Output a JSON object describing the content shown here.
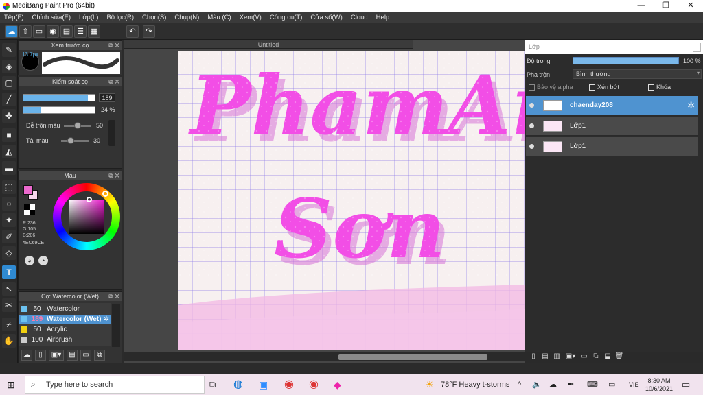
{
  "window": {
    "title": "MediBang Paint Pro (64bit)",
    "minimize": "—",
    "maximize": "❐",
    "close": "✕"
  },
  "menu": [
    "Tệp(F)",
    "Chỉnh sửa(E)",
    "Lớp(L)",
    "Bộ lọc(R)",
    "Chọn(S)",
    "Chụp(N)",
    "Màu (C)",
    "Xem(V)",
    "Công cụ(T)",
    "Cửa sổ(W)",
    "Cloud",
    "Help"
  ],
  "preview": {
    "title": "Xem trước cọ",
    "size_value": "13.7px"
  },
  "brush_control": {
    "title": "Kiểm soát cọ",
    "size": "189",
    "opacity": "24 %",
    "opacity_level": 0.24,
    "size_level": 0.9,
    "mix_label": "Dễ trộn màu",
    "mix_value": "50",
    "mix_level": 0.5,
    "paint_label": "Tải màu",
    "paint_value": "30",
    "paint_level": 0.3
  },
  "color": {
    "title": "Màu",
    "r": "R:236",
    "g": "G:105",
    "b": "B:206",
    "hex": "#EC69CE",
    "fg": "#ec69ce",
    "bg": "#f6d6ec"
  },
  "brush_list": {
    "title": "Cọ: Watercolor (Wet)",
    "items": [
      {
        "size": "50",
        "name": "Watercolor",
        "color": "#6cc2f0"
      },
      {
        "size": "189",
        "name": "Watercolor (Wet)",
        "color": "#6cc2f0"
      },
      {
        "size": "50",
        "name": "Acrylic",
        "color": "#f0d010"
      },
      {
        "size": "100",
        "name": "Airbrush",
        "color": "#cccccc"
      }
    ]
  },
  "document": {
    "tab": "Untitled",
    "text_line1": "PhamAn",
    "text_line2": "Sơn"
  },
  "layers": {
    "title": "Lớp",
    "opacity_label": "Độ trong",
    "opacity_value": "100 %",
    "blend_label": "Pha trộn",
    "blend_value": "Bình thường",
    "protect_alpha": "Bảo vệ alpha",
    "clipping": "Xén bớt",
    "lock": "Khóa",
    "items": [
      {
        "name": "chaenday208"
      },
      {
        "name": "Lớp1"
      },
      {
        "name": "Lớp1"
      }
    ]
  },
  "taskbar": {
    "search_placeholder": "Type here to search",
    "weather": "78°F  Heavy t-storms",
    "lang": "VIE",
    "time": "8:30 AM",
    "date": "10/6/2021"
  }
}
